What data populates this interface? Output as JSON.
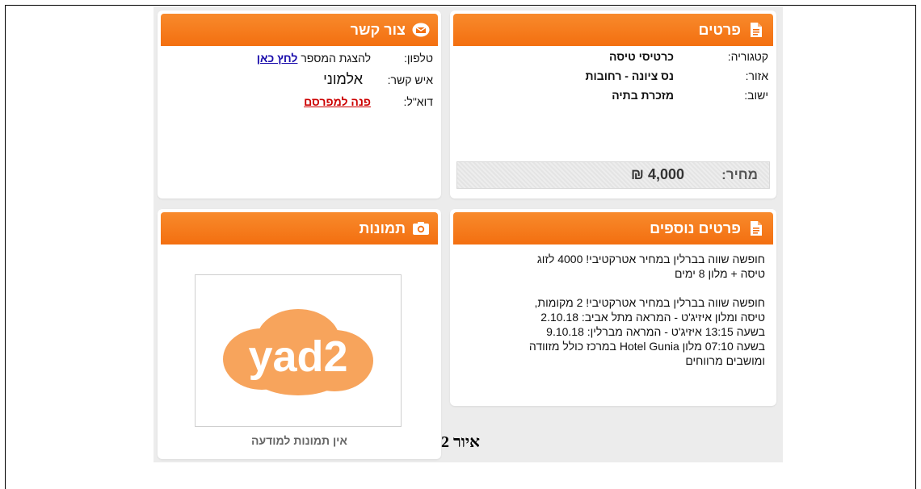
{
  "details": {
    "title": "פרטים",
    "rows": [
      {
        "label": "קטגוריה:",
        "value": "כרטיסי טיסה"
      },
      {
        "label": "אזור:",
        "value": "נס ציונה - רחובות"
      },
      {
        "label": "ישוב:",
        "value": "מזכרת בתיה"
      }
    ],
    "price_label": "מחיר:",
    "price_value": "4,000 ₪"
  },
  "contact": {
    "title": "צור קשר",
    "phone_label": "טלפון:",
    "phone_text": "להצגת המספר",
    "phone_link": "לחץ כאן",
    "person_label": "איש קשר:",
    "person_value": "אלמוני",
    "email_label": "דוא\"ל:",
    "email_link": "פנה למפרסם"
  },
  "extra": {
    "title": "פרטים נוספים",
    "text": "חופשה שווה בברלין במחיר אטרקטיבי! 4000 לזוג\nטיסה + מלון 8 ימים\n\nחופשה שווה בברלין במחיר אטרקטיבי! 2 מקומות,\nטיסה ומלון איזיג'ט - המראה מתל אביב: 2.10.18\nבשעה 13:15 איזיג'ט - המראה מברלין: 9.10.18\nבשעה 07:10 מלון Hotel Gunia במרכז כולל מזוודה\nומושבים מרווחים"
  },
  "photos": {
    "title": "תמונות",
    "logo_text": "yad2",
    "no_photos": "אין תמונות למודעה"
  },
  "caption": "איור 2",
  "colors": {
    "accent": "#f36f10",
    "logo": "#f7a45c"
  },
  "icons": [
    "document-icon",
    "envelope-icon",
    "camera-icon"
  ]
}
